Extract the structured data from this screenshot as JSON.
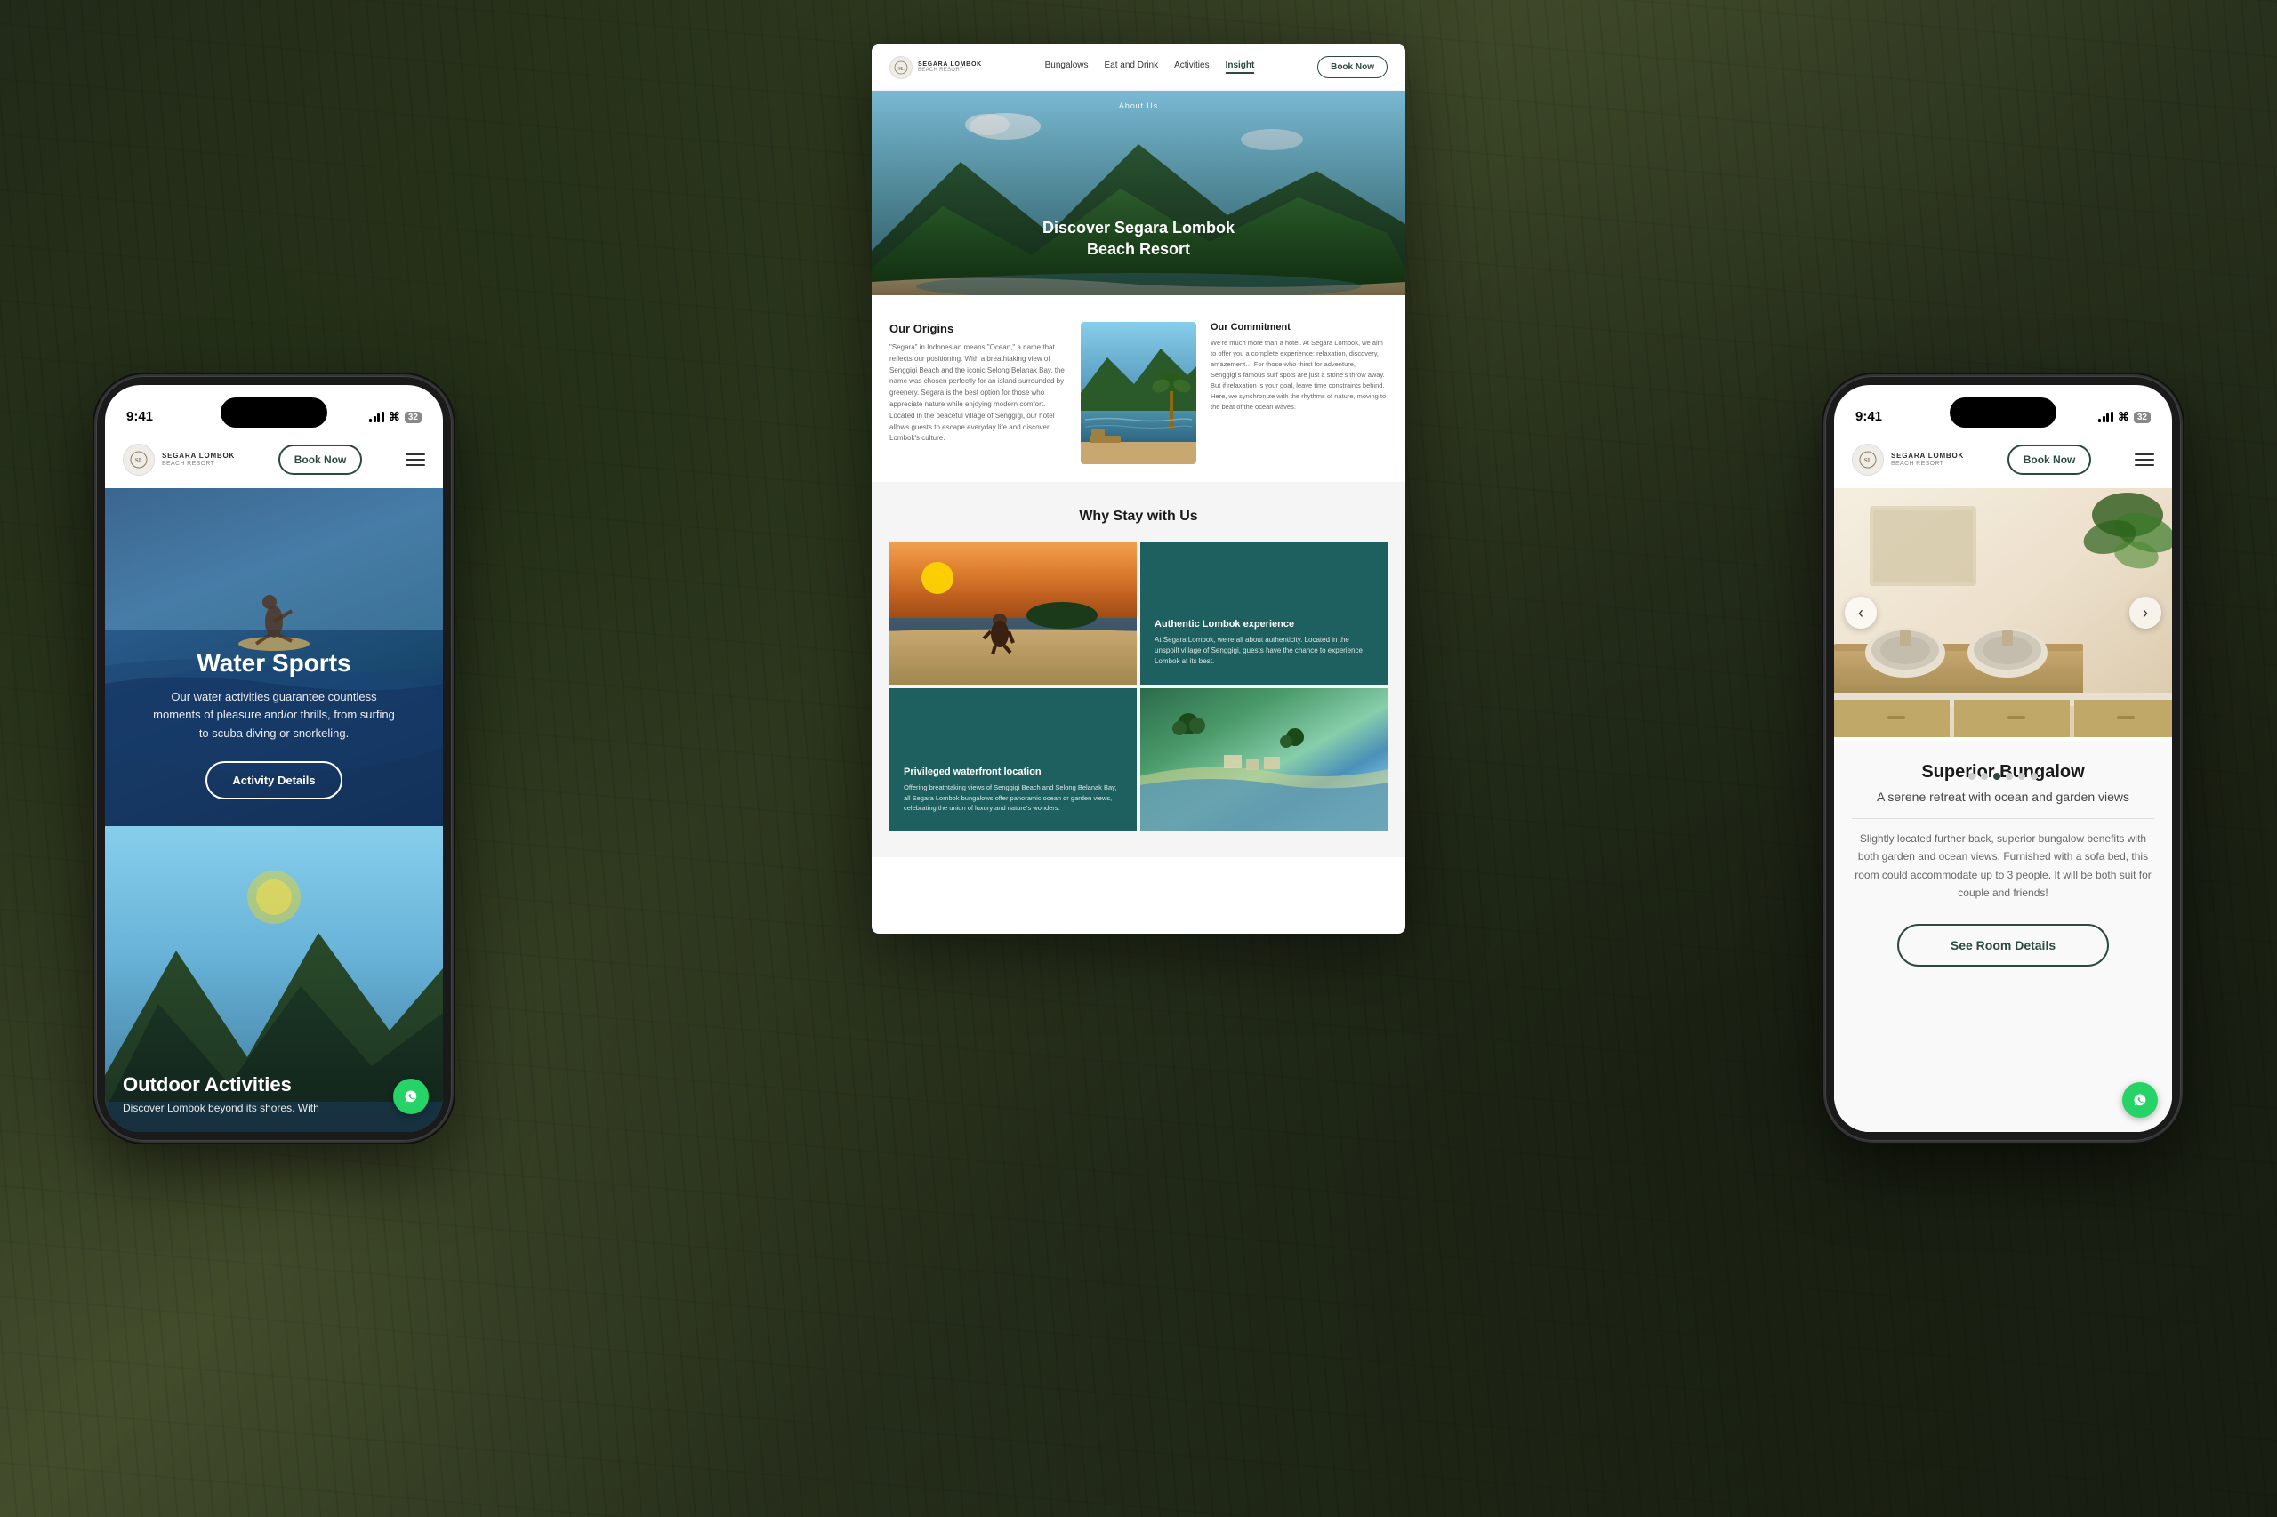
{
  "background": {
    "description": "Bamboo/wood texture dark forest background"
  },
  "left_phone": {
    "status_bar": {
      "time": "9:41",
      "signal": true,
      "link_icon": "⌗",
      "badge": "32"
    },
    "nav": {
      "logo_line1": "SEGARA LOMBOK",
      "logo_line2": "BEACH RESORT",
      "book_now": "Book Now",
      "hamburger": "menu"
    },
    "hero": {
      "title": "Water Sports",
      "description": "Our water activities guarantee countless moments of pleasure and/or thrills, from surfing to scuba diving or snorkeling.",
      "cta": "Activity Details"
    },
    "outdoor": {
      "title": "Outdoor Activities",
      "description": "Discover Lombok beyond its shores. With"
    },
    "chat_icon": "💬"
  },
  "desktop": {
    "nav": {
      "logo_line1": "SEGARA LOMBOK",
      "logo_line2": "BEACH RESORT",
      "links": [
        "Bungalows",
        "Eat and Drink",
        "Activities",
        "Insight"
      ],
      "active_link": "Insight",
      "book_now": "Book Now"
    },
    "hero": {
      "about_label": "About Us",
      "title_line1": "Discover Segara Lombok",
      "title_line2": "Beach Resort"
    },
    "origins": {
      "title": "Our Origins",
      "body": "\"Segara\" in Indonesian means \"Ocean,\" a name that reflects our positioning. With a breathtaking view of Senggigi Beach and the iconic Selong Belanak Bay, the name was chosen perfectly for an island surrounded by greenery. Segara is the best option for those who appreciate nature while enjoying modern comfort. Located in the peaceful village of Senggigi, our hotel allows guests to escape everyday life and discover Lombok's culture."
    },
    "commitment": {
      "title": "Our Commitment",
      "body": "We're much more than a hotel. At Segara Lombok, we aim to offer you a complete experience: relaxation, discovery, amazement… For those who thirst for adventure, Senggigi's famous surf spots are just a stone's throw away. But if relaxation is your goal, leave time constraints behind. Here, we synchronize with the rhythms of nature, moving to the beat of the ocean waves."
    },
    "why_stay": {
      "title": "Why Stay with Us",
      "card1_title": "Authentic Lombok experience",
      "card1_body": "At Segara Lombok, we're all about authenticity. Located in the unspoilt village of Senggigi, guests have the chance to experience Lombok at its best.",
      "card2_title": "Privileged waterfront location",
      "card2_body": "Offering breathtaking views of Senggigi Beach and Selong Belanak Bay, all Segara Lombok bungalows offer panoramic ocean or garden views, celebrating the union of luxury and nature's wonders."
    }
  },
  "right_phone": {
    "status_bar": {
      "time": "9:41",
      "signal": true,
      "link_icon": "⌗",
      "badge": "32"
    },
    "nav": {
      "logo_line1": "SEGARA LOMBOK",
      "logo_line2": "BEACH RESORT",
      "book_now": "Book Now",
      "hamburger": "menu"
    },
    "carousel_dots": [
      false,
      false,
      true,
      false,
      false,
      false
    ],
    "room": {
      "title": "Superior Bungalow",
      "subtitle": "A serene retreat with ocean and garden views",
      "description": "Slightly located further back, superior bungalow benefits with both garden and ocean views. Furnished with a sofa bed, this room could accommodate up to 3 people. It will be both suit for couple and friends!",
      "cta": "See Room Details",
      "arrows": {
        "left": "‹",
        "right": "›"
      }
    },
    "chat_icon": "💬"
  }
}
